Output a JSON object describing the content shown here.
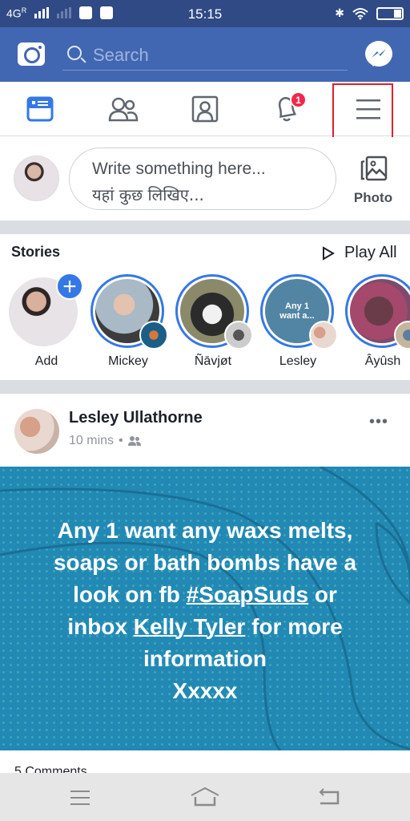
{
  "status_bar": {
    "network": "4G",
    "roaming": "R",
    "time": "15:15",
    "icons": [
      "signal-icon",
      "signal-weak-icon",
      "instagram-icon",
      "microphone-icon",
      "bluetooth-icon",
      "wifi-icon",
      "battery-icon"
    ]
  },
  "top_bar": {
    "search_placeholder": "Search",
    "icons": [
      "camera-icon",
      "search-icon",
      "messenger-icon"
    ]
  },
  "nav_tabs": [
    {
      "name": "news-feed",
      "icon": "news-feed-icon",
      "active": true
    },
    {
      "name": "friends",
      "icon": "friends-icon",
      "active": false
    },
    {
      "name": "profile",
      "icon": "profile-icon",
      "active": false
    },
    {
      "name": "notifications",
      "icon": "bell-icon",
      "badge": "1",
      "active": false
    },
    {
      "name": "menu",
      "icon": "hamburger-menu-icon",
      "active": false,
      "highlighted": true
    }
  ],
  "colors": {
    "brand": "#4267b2",
    "status_bar": "#2f4a85",
    "accent": "#3578e5",
    "badge": "#f0284a",
    "highlight": "#e0202a",
    "post_bg": "#2289b4"
  },
  "composer": {
    "placeholder_en": "Write something here...",
    "placeholder_hi": "यहां कुछ लिखिए...",
    "photo_label": "Photo"
  },
  "stories": {
    "title": "Stories",
    "play_all": "Play All",
    "items": [
      {
        "name": "Add"
      },
      {
        "name": "Mickey"
      },
      {
        "name": "Ñāvjøt"
      },
      {
        "name": "Lesley",
        "preview_text": "Any 1 want a..."
      },
      {
        "name": "Âyûsh"
      }
    ]
  },
  "post": {
    "author": "Lesley Ullathorne",
    "time": "10 mins",
    "separator": "•",
    "audience_icon": "friends-audience-icon",
    "text_lines": [
      "Any 1 want any waxs melts,",
      "soaps or bath bombs  have a",
      "look on fb ",
      "#SoapSuds",
      " or",
      "inbox ",
      "Kelly Tyler",
      " for more",
      "information",
      "Xxxxx"
    ],
    "comments": "5 Comments"
  },
  "system_nav": {
    "icons": [
      "recent-apps-icon",
      "home-icon",
      "back-icon"
    ]
  }
}
